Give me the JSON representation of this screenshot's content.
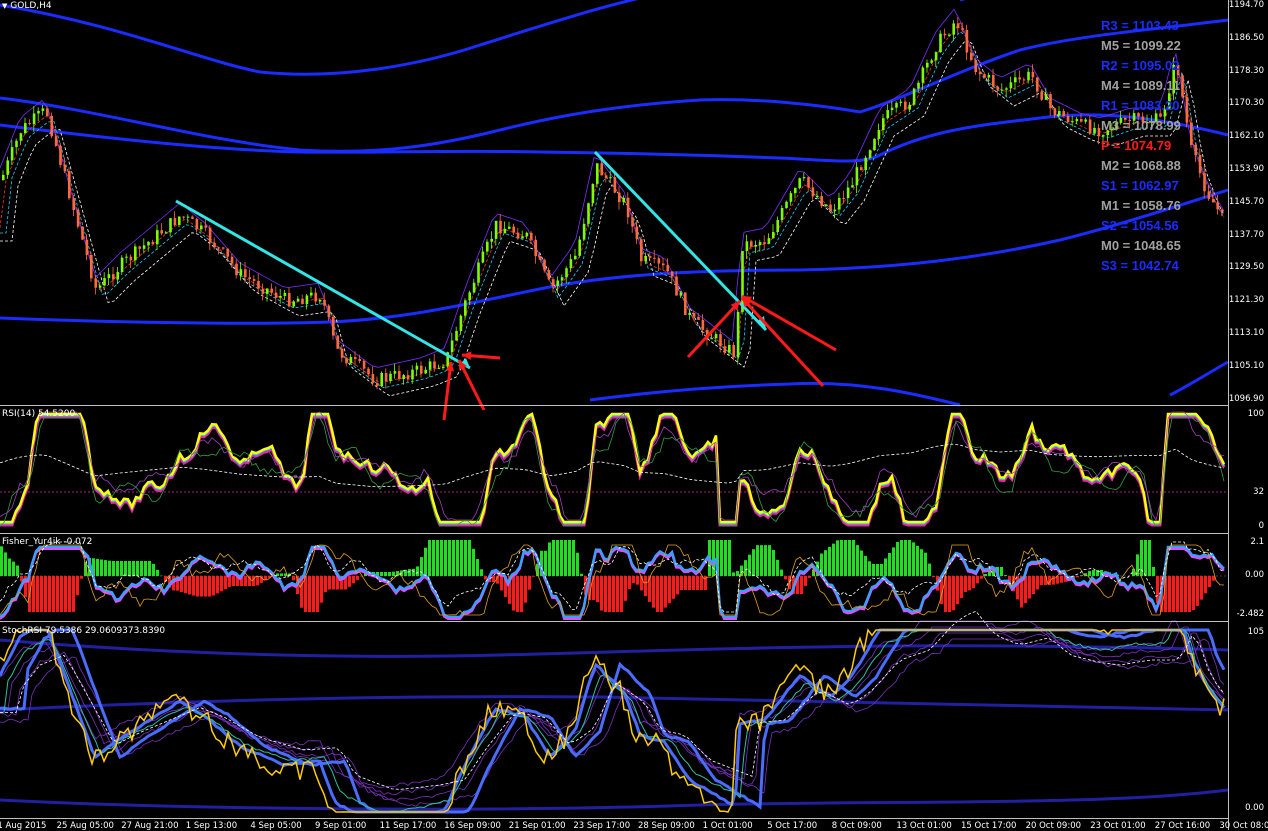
{
  "colors": {
    "background": "#000000",
    "bull_candle": "#7cfc00",
    "bear_candle": "#ff6a3d",
    "band_blue": "#1a2cff",
    "trendline_cyan": "#33e5e5",
    "arrow_red": "#ff1a1a",
    "rsi_yellow": "#ffff00",
    "rsi_magenta": "#ff1aa0",
    "rsi_cyan": "#1ad0ff",
    "hist_green": "#22dd22",
    "hist_red": "#ff1a1a",
    "pivot_blue": "#1a2cff",
    "pivot_gray": "#a0a0a0",
    "pivot_red": "#ff1a1a"
  },
  "main_panel": {
    "symbol": "GOLD,H4",
    "price_axis": [
      "1194.70",
      "1186.50",
      "1178.30",
      "1170.30",
      "1162.10",
      "1153.90",
      "1145.70",
      "1137.70",
      "1129.50",
      "1121.30",
      "1113.10",
      "1105.10",
      "1096.90"
    ],
    "pivots": [
      {
        "label": "R3 = 1103.43",
        "color": "blue"
      },
      {
        "label": "M5 = 1099.22",
        "color": "gray"
      },
      {
        "label": "R2 = 1095.02",
        "color": "blue"
      },
      {
        "label": "M4 = 1089.11",
        "color": "gray"
      },
      {
        "label": "R1 = 1083.20",
        "color": "blue"
      },
      {
        "label": "M3 = 1078.99",
        "color": "gray"
      },
      {
        "label": "P  = 1074.79",
        "color": "red"
      },
      {
        "label": "M2 = 1068.88",
        "color": "gray"
      },
      {
        "label": "S1 = 1062.97",
        "color": "blue"
      },
      {
        "label": "M1 = 1058.76",
        "color": "gray"
      },
      {
        "label": "S2 = 1054.56",
        "color": "blue"
      },
      {
        "label": "M0 = 1048.65",
        "color": "gray"
      },
      {
        "label": "S3 = 1042.74",
        "color": "blue"
      }
    ]
  },
  "rsi_panel": {
    "title": "RSI(14) 54.5200",
    "axis": [
      "100",
      "32",
      "0"
    ]
  },
  "fisher_panel": {
    "title": "Fisher_Yur4ik -0.072",
    "axis": [
      "2.1",
      "0.00",
      "-2.482"
    ]
  },
  "stoch_panel": {
    "title": "StochRSI 79.5386 29.0609373.8390",
    "axis": [
      "105",
      "0.00"
    ]
  },
  "time_axis": [
    "21 Aug 2015",
    "25 Aug 05:00",
    "27 Aug 21:00",
    "1 Sep 13:00",
    "4 Sep 05:00",
    "9 Sep 01:00",
    "11 Sep 17:00",
    "16 Sep 09:00",
    "21 Sep 01:00",
    "23 Sep 17:00",
    "28 Sep 09:00",
    "1 Oct 01:00",
    "5 Oct 17:00",
    "8 Oct 09:00",
    "13 Oct 01:00",
    "15 Oct 17:00",
    "20 Oct 09:00",
    "23 Oct 01:00",
    "27 Oct 16:00",
    "30 Oct 08:00"
  ]
}
